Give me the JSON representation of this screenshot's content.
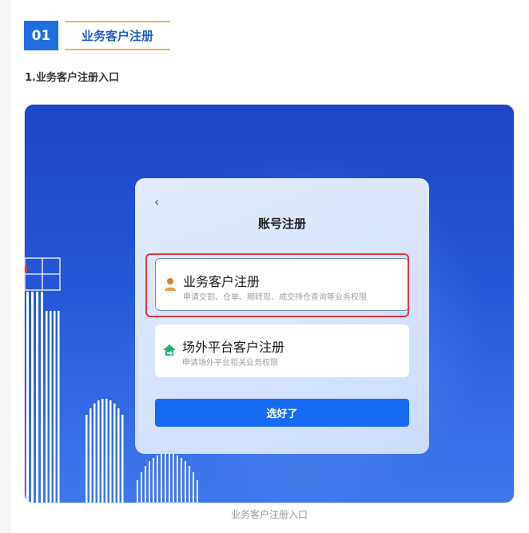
{
  "section": {
    "number": "01",
    "title": "业务客户注册"
  },
  "step": {
    "title": "1.业务客户注册入口"
  },
  "dialog": {
    "title": "账号注册",
    "options": [
      {
        "label": "业务客户注册",
        "desc": "申请交割、仓单、期转现、成交持仓查询等业务权限",
        "icon": "person-icon",
        "icon_color": "#f07a2a",
        "highlighted": true
      },
      {
        "label": "场外平台客户注册",
        "desc": "申请场外平台相关业务权限",
        "icon": "house-arrow-icon",
        "icon_color": "#23b36b",
        "highlighted": false
      }
    ],
    "confirm_label": "选好了"
  },
  "caption": "业务客户注册入口",
  "colors": {
    "accent": "#1f6fe0",
    "gold": "#e0b75c",
    "highlight": "#e23a36",
    "button": "#1669f2"
  }
}
